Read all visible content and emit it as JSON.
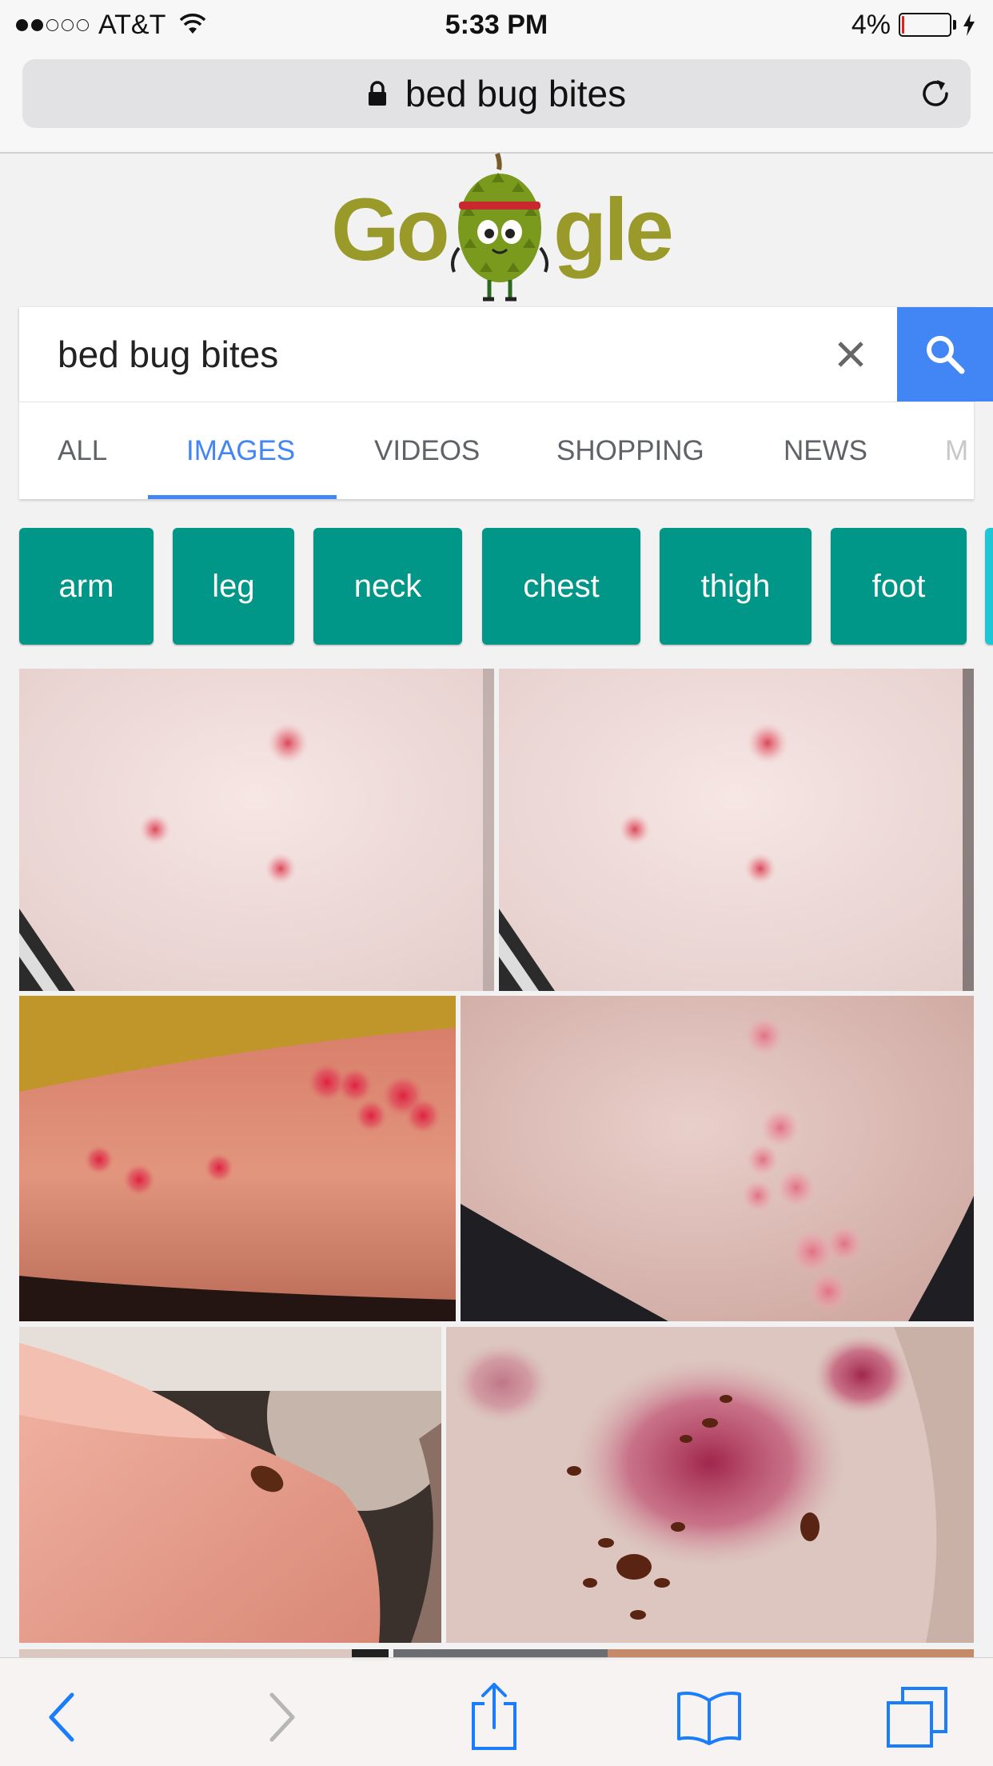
{
  "status_bar": {
    "carrier": "AT&T",
    "time": "5:33 PM",
    "battery_percent": "4%",
    "battery_level": 0.04,
    "signal_bars_filled": 2,
    "signal_bars_total": 5
  },
  "browser": {
    "url_display": "bed bug bites"
  },
  "search": {
    "query": "bed bug bites"
  },
  "tabs": [
    {
      "label": "ALL",
      "active": false
    },
    {
      "label": "IMAGES",
      "active": true
    },
    {
      "label": "VIDEOS",
      "active": false
    },
    {
      "label": "SHOPPING",
      "active": false
    },
    {
      "label": "NEWS",
      "active": false
    },
    {
      "label": "M",
      "active": false
    }
  ],
  "chips": [
    "arm",
    "leg",
    "neck",
    "chest",
    "thigh",
    "foot"
  ],
  "colors": {
    "accent_blue": "#4285f4",
    "chip_teal": "#009688",
    "battery_red": "#e0201b",
    "ios_blue": "#1a7dfc"
  },
  "icons": {
    "lock": "lock-icon",
    "reload": "reload-icon",
    "clear": "close-icon",
    "search": "search-icon",
    "back": "chevron-left-icon",
    "forward": "chevron-right-icon",
    "share": "share-icon",
    "bookmarks": "book-icon",
    "tabs": "tabs-icon"
  }
}
